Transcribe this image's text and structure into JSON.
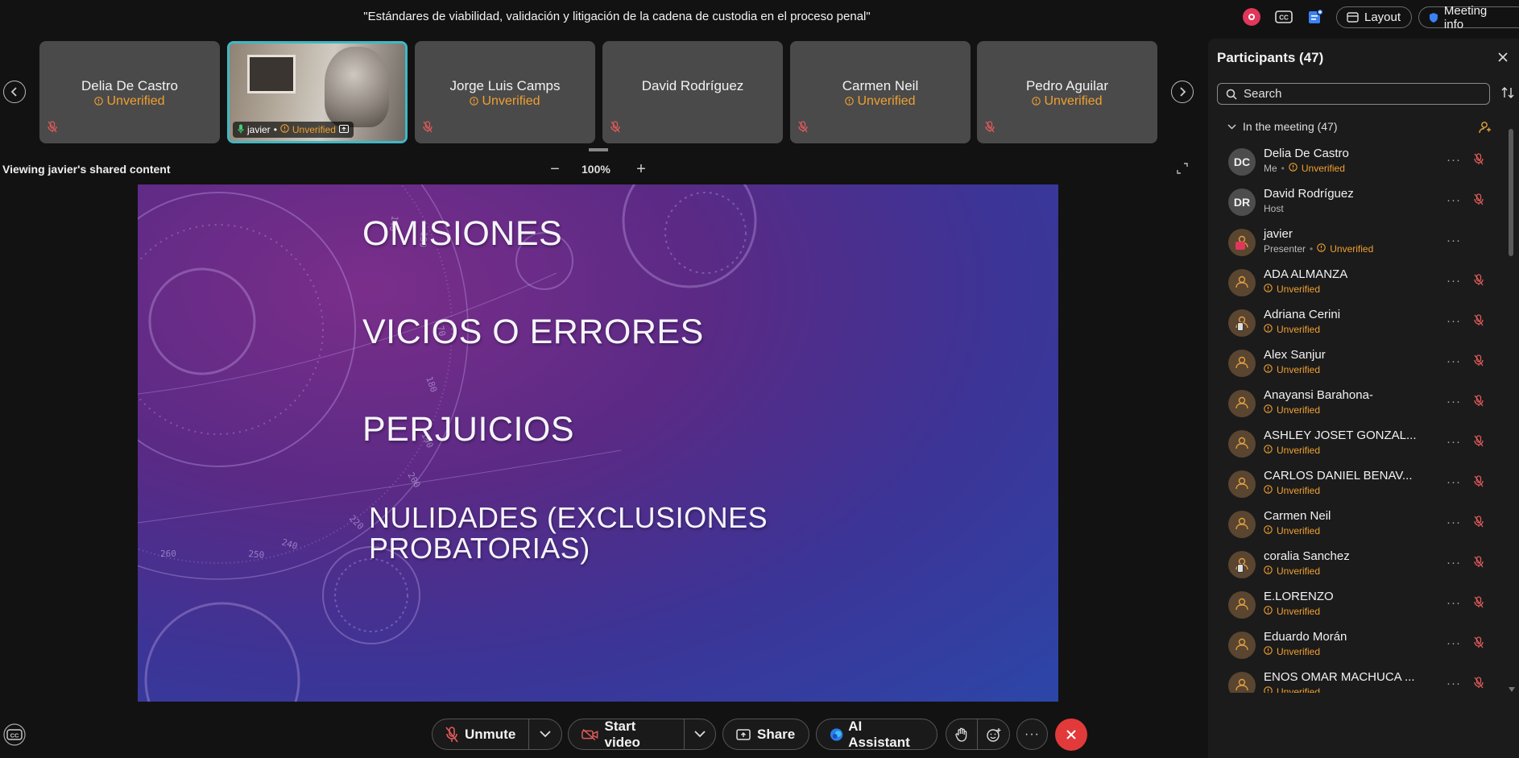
{
  "meeting": {
    "title": "\"Estándares de viabilidad, validación y litigación de la cadena de custodia en el proceso penal\"",
    "layout_label": "Layout",
    "meeting_info_label": "Meeting info"
  },
  "filmstrip": [
    {
      "name": "Delia De Castro",
      "status": "Unverified",
      "video": false
    },
    {
      "name": "javier",
      "status": "Unverified",
      "video": true
    },
    {
      "name": "Jorge Luis Camps",
      "status": "Unverified",
      "video": false
    },
    {
      "name": "David Rodríguez",
      "status": "",
      "video": false
    },
    {
      "name": "Carmen Neil",
      "status": "Unverified",
      "video": false
    },
    {
      "name": "Pedro Aguilar",
      "status": "Unverified",
      "video": false
    }
  ],
  "share": {
    "viewing_text": "Viewing javier's shared content",
    "zoom": "100%"
  },
  "slide": {
    "lines": [
      "OMISIONES",
      "VICIOS  O ERRORES",
      "PERJUICIOS",
      "NULIDADES (EXCLUSIONES",
      "PROBATORIAS)"
    ],
    "dial_numbers": [
      "170",
      "180",
      "190",
      "200",
      "220",
      "240",
      "250",
      "260",
      "150",
      "140"
    ]
  },
  "toolbar": {
    "unmute": "Unmute",
    "start_video": "Start video",
    "share": "Share",
    "ai_assistant": "AI Assistant"
  },
  "participants": {
    "title": "Participants (47)",
    "search_placeholder": "Search",
    "section": "In the meeting (47)",
    "list": [
      {
        "initials": "DC",
        "name": "Delia De Castro",
        "role": "Me",
        "status": "Unverified",
        "guest": false
      },
      {
        "initials": "DR",
        "name": "David Rodríguez",
        "role": "Host",
        "status": "",
        "guest": false
      },
      {
        "initials": "",
        "name": "javier",
        "role": "Presenter",
        "status": "Unverified",
        "guest": true
      },
      {
        "initials": "",
        "name": "ADA ALMANZA",
        "role": "",
        "status": "Unverified",
        "guest": true
      },
      {
        "initials": "",
        "name": "Adriana Cerini",
        "role": "",
        "status": "Unverified",
        "guest": true
      },
      {
        "initials": "",
        "name": "Alex Sanjur",
        "role": "",
        "status": "Unverified",
        "guest": true
      },
      {
        "initials": "",
        "name": "Anayansi Barahona-",
        "role": "",
        "status": "Unverified",
        "guest": true
      },
      {
        "initials": "",
        "name": "ASHLEY JOSET GONZAL...",
        "role": "",
        "status": "Unverified",
        "guest": true
      },
      {
        "initials": "",
        "name": "CARLOS DANIEL BENAV...",
        "role": "",
        "status": "Unverified",
        "guest": true
      },
      {
        "initials": "",
        "name": "Carmen Neil",
        "role": "",
        "status": "Unverified",
        "guest": true
      },
      {
        "initials": "",
        "name": "coralia Sanchez",
        "role": "",
        "status": "Unverified",
        "guest": true
      },
      {
        "initials": "",
        "name": "E.LORENZO",
        "role": "",
        "status": "Unverified",
        "guest": true
      },
      {
        "initials": "",
        "name": "Eduardo Morán",
        "role": "",
        "status": "Unverified",
        "guest": true
      },
      {
        "initials": "",
        "name": "ENOS OMAR MACHUCA ...",
        "role": "",
        "status": "Unverified",
        "guest": true
      }
    ]
  },
  "colors": {
    "unverified": "#f0a030",
    "accent_teal": "#3fb8c5",
    "end_call": "#e23a3a",
    "recording": "#e0375a"
  }
}
